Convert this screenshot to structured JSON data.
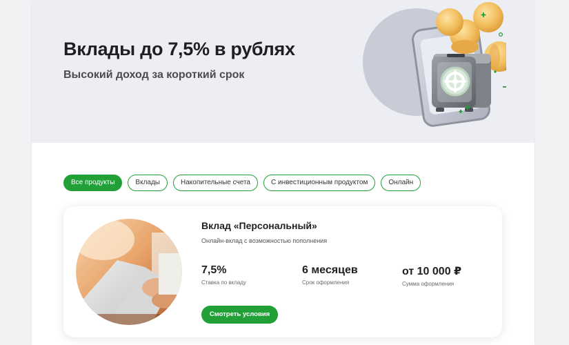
{
  "hero": {
    "title": "Вклады до 7,5% в рублях",
    "subtitle": "Высокий доход за короткий срок",
    "illustration_icon": "safe-with-coins-icon"
  },
  "filters": [
    {
      "label": "Все продукты",
      "active": true
    },
    {
      "label": "Вклады",
      "active": false
    },
    {
      "label": "Накопительные счета",
      "active": false
    },
    {
      "label": "С инвестиционным продуктом",
      "active": false
    },
    {
      "label": "Онлайн",
      "active": false
    }
  ],
  "product": {
    "title": "Вклад «Персональный»",
    "description": "Онлайн-вклад с возможностью пополнения",
    "stats": [
      {
        "value": "7,5%",
        "label": "Ставка по вкладу"
      },
      {
        "value": "6 месяцев",
        "label": "Срок оформления"
      },
      {
        "value": "от 10 000 ₽",
        "label": "Сумма оформления"
      }
    ],
    "cta_label": "Смотреть условия",
    "photo_icon": "laptop-hands-photo"
  },
  "colors": {
    "accent": "#21a038",
    "hero_bg": "#eceef4",
    "page_bg": "#f2f2f4",
    "coin": "#f0b955"
  }
}
